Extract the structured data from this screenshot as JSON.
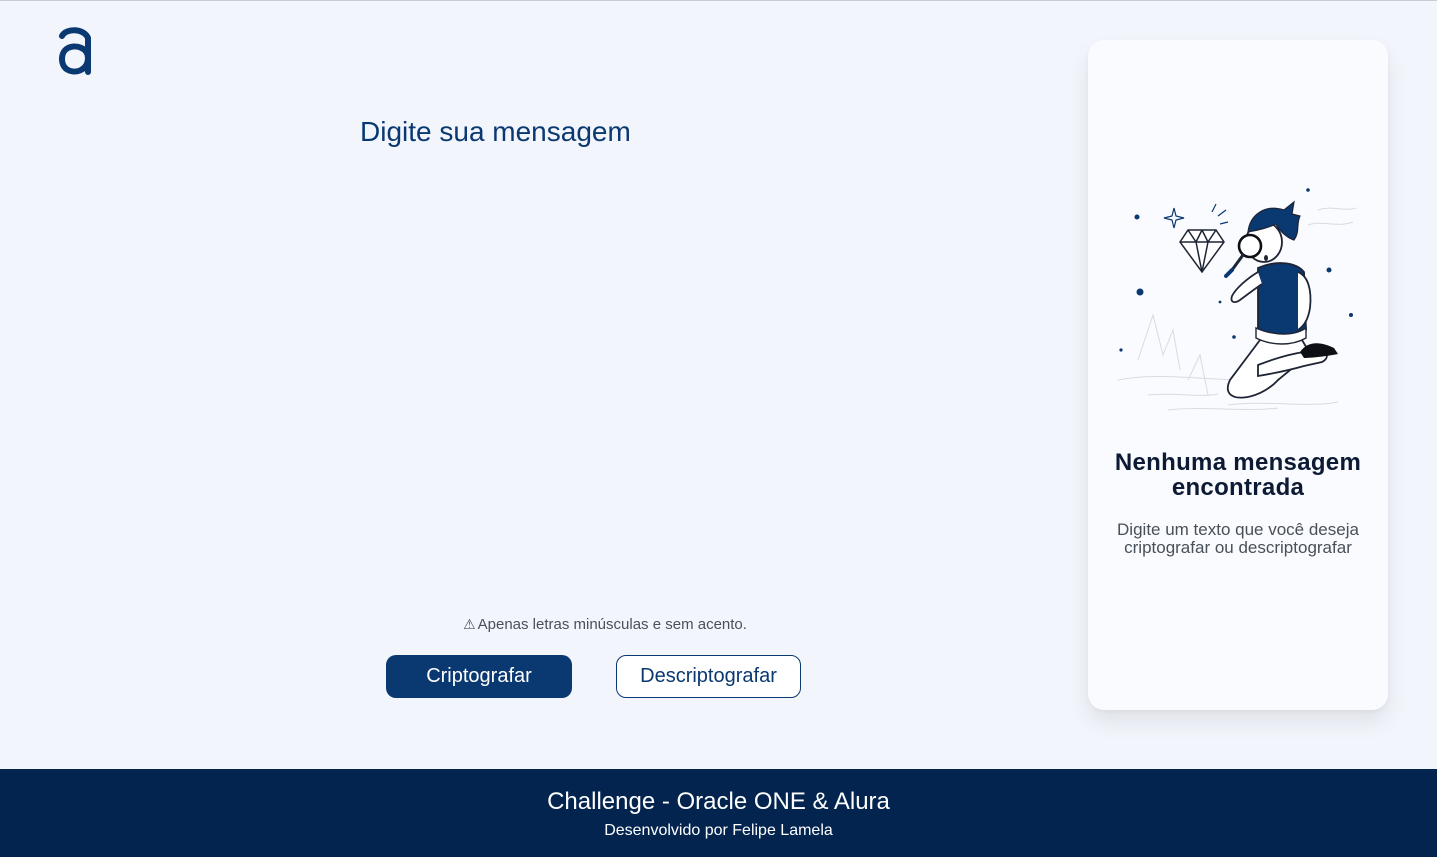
{
  "brand": {
    "logo_icon": "alura-logo-icon",
    "logo_letter": "a"
  },
  "editor": {
    "placeholder": "Digite sua mensagem",
    "value": ""
  },
  "hint": {
    "icon": "warning-icon",
    "icon_glyph": "⚠",
    "text": "Apenas letras minúsculas e sem acento."
  },
  "actions": {
    "encrypt_label": "Criptografar",
    "decrypt_label": "Descriptografar"
  },
  "output_panel": {
    "illustration": "person-with-magnifying-glass-illustration",
    "title": "Nenhuma mensagem encontrada",
    "text": "Digite um texto que você deseja criptografar ou descriptografar"
  },
  "footer": {
    "title": "Challenge - Oracle ONE & Alura",
    "credit": "Desenvolvido por Felipe Lamela"
  },
  "colors": {
    "primary": "#0a3871",
    "footer_bg": "#03244f",
    "page_bg": "#f3f5fc",
    "card_bg": "#fafbff"
  }
}
